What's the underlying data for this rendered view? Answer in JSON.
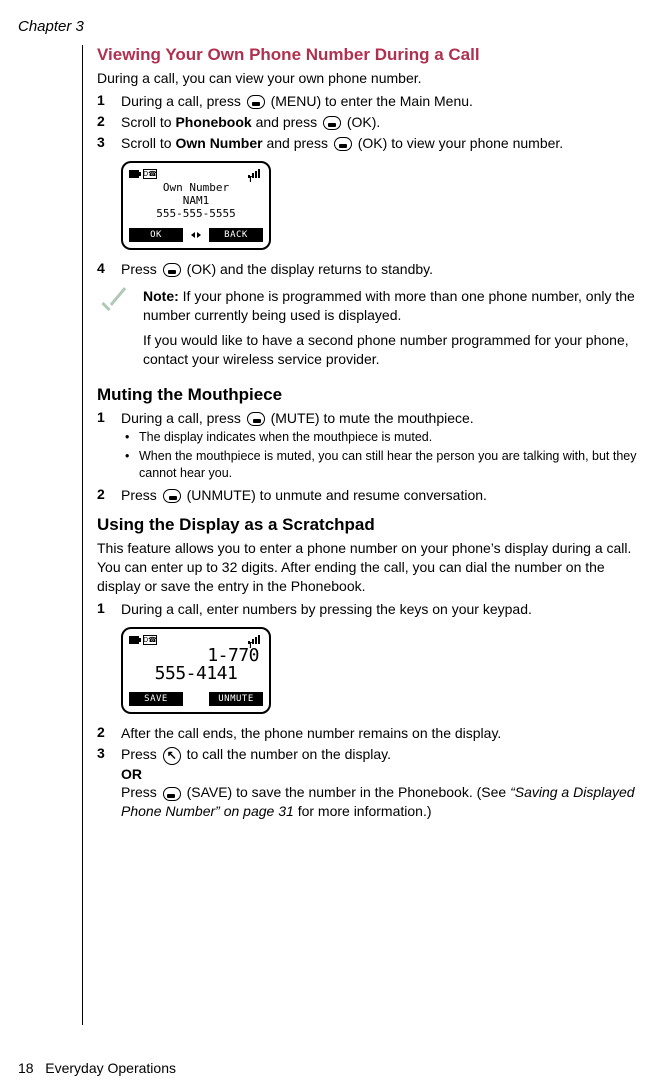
{
  "chapter": "Chapter 3",
  "footer_page": "18",
  "footer_title": "Everyday Operations",
  "sec1": {
    "title": "Viewing Your Own Phone Number During a Call",
    "intro": "During a call, you can view your own phone number.",
    "step1_num": "1",
    "step1_a": "During a call, press ",
    "step1_b": " (MENU) to enter the Main Menu.",
    "step2_num": "2",
    "step2_a": "Scroll to ",
    "step2_bold": "Phonebook",
    "step2_b": " and press ",
    "step2_c": " (OK).",
    "step3_num": "3",
    "step3_a": "Scroll to ",
    "step3_bold": "Own Number",
    "step3_b": " and press ",
    "step3_c": " (OK) to view your phone number.",
    "screen": {
      "line1": "Own Number",
      "line2": "NAM1",
      "line3": "555-555-5555",
      "soft_left": "OK",
      "soft_right": "BACK"
    },
    "step4_num": "4",
    "step4_a": "Press ",
    "step4_b": " (OK) and the display returns to standby."
  },
  "note": {
    "label": "Note:",
    "p1": " If your phone is programmed with more than one phone number, only the number currently being used is displayed.",
    "p2": "If you would like to have a second phone number programmed for your phone, contact your wireless service provider."
  },
  "sec2": {
    "title": "Muting the Mouthpiece",
    "step1_num": "1",
    "step1_a": "During a call, press ",
    "step1_b": " (MUTE) to mute the mouthpiece.",
    "bullet1": "The display indicates when the mouthpiece is muted.",
    "bullet2": "When the mouthpiece is muted, you can still hear the person you are talking with, but they cannot hear you.",
    "step2_num": "2",
    "step2_a": "Press ",
    "step2_b": " (UNMUTE) to unmute and resume conversation."
  },
  "sec3": {
    "title": "Using the Display as a Scratchpad",
    "intro": "This feature allows you to enter a phone number on your phone’s display during a call. You can enter up to 32 digits. After ending the call, you can dial the number on the display or save the entry in the Phonebook.",
    "step1_num": "1",
    "step1": "During a call, enter numbers by pressing the keys on your keypad.",
    "screen": {
      "big1": "1-770",
      "big2": "555-4141",
      "soft_left": "SAVE",
      "soft_right": "UNMUTE"
    },
    "step2_num": "2",
    "step2": "After the call ends, the phone number remains on the display.",
    "step3_num": "3",
    "step3_a": "Press ",
    "step3_b": " to call the number on the display.",
    "or": "OR",
    "step3_c": "Press ",
    "step3_d": " (SAVE) to save the number in the Phonebook. (See ",
    "step3_ital": "“Saving a Displayed Phone Number” on page 31",
    "step3_e": " for more information.)"
  }
}
